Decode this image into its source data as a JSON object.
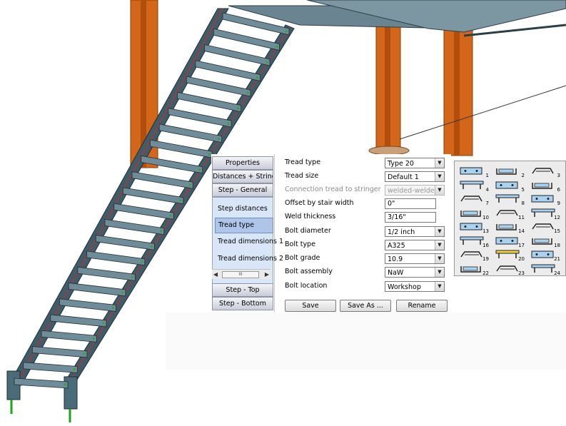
{
  "navigation": {
    "top_buttons": [
      "Properties",
      "Distances + Stringer",
      "Step - General"
    ],
    "list_items": [
      "Step distances",
      "Tread type",
      "Tread dimensions 1",
      "Tread dimensions 2"
    ],
    "selected_item": "Tread type",
    "scrollbar_thumb": "III",
    "bottom_buttons": [
      "Step - Top",
      "Step - Bottom"
    ]
  },
  "properties": [
    {
      "label": "Tread type",
      "value": "Type 20",
      "control": "dropdown",
      "enabled": true
    },
    {
      "label": "Tread size",
      "value": "Default 1",
      "control": "dropdown",
      "enabled": true
    },
    {
      "label": "Connection tread to stringer",
      "value": "welded-welded",
      "control": "dropdown",
      "enabled": false
    },
    {
      "label": "Offset by stair width",
      "value": "0\"",
      "control": "text",
      "enabled": true
    },
    {
      "label": "Weld thickness",
      "value": "3/16\"",
      "control": "text",
      "enabled": true
    },
    {
      "label": "Bolt diameter",
      "value": "1/2 inch",
      "control": "dropdown",
      "enabled": true
    },
    {
      "label": "Bolt type",
      "value": "A325",
      "control": "dropdown",
      "enabled": true
    },
    {
      "label": "Bolt grade",
      "value": "10.9",
      "control": "dropdown",
      "enabled": true
    },
    {
      "label": "Bolt assembly",
      "value": "NaW",
      "control": "dropdown",
      "enabled": true
    },
    {
      "label": "Bolt location",
      "value": "Workshop",
      "control": "dropdown",
      "enabled": true
    }
  ],
  "buttons": {
    "save": "Save",
    "save_as": "Save As ...",
    "rename": "Rename"
  },
  "tread_catalog": {
    "numbers": [
      "1",
      "2",
      "3",
      "4",
      "5",
      "6",
      "7",
      "8",
      "9",
      "10",
      "11",
      "12",
      "13",
      "14",
      "15",
      "16",
      "17",
      "18",
      "19",
      "20",
      "21",
      "22",
      "23",
      "24"
    ],
    "selected": "20"
  },
  "colors": {
    "steel_column": "#d4661a",
    "stair_steel": "#4a6b78",
    "nav_selection": "#aec4e8",
    "selected_tread": "#f2d43a",
    "plate_fill": "#a9d2f0"
  }
}
